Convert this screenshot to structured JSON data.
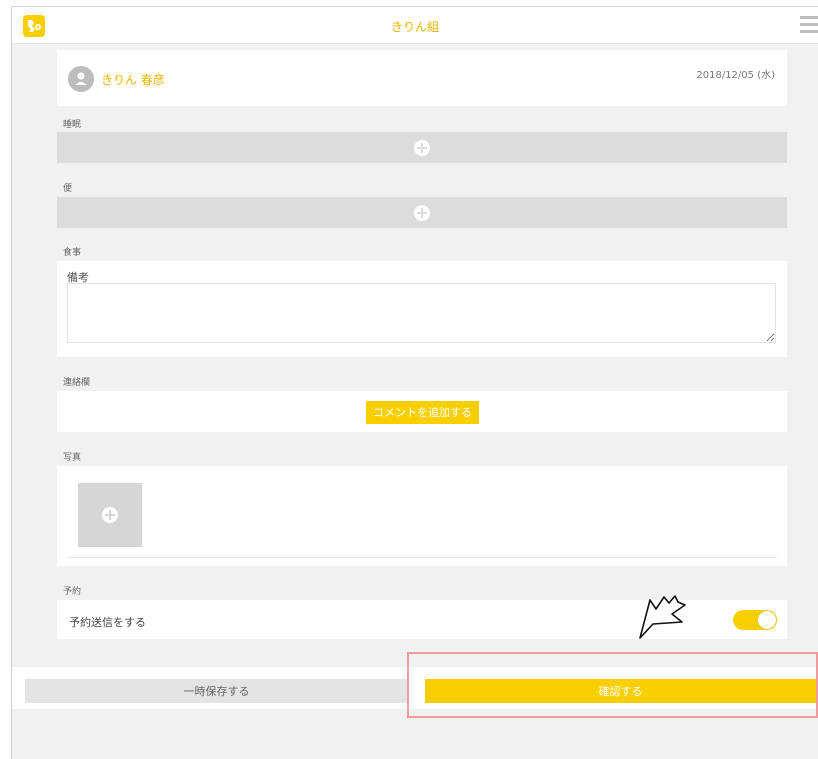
{
  "header": {
    "title": "きりん組"
  },
  "user": {
    "name": "きりん 春彦",
    "date": "2018/12/05 (水)"
  },
  "sections": {
    "sleep": "睡眠",
    "stool": "便",
    "meal": "食事",
    "remarks": "備考",
    "contact": "連絡欄",
    "photo": "写真",
    "reservation": "予約"
  },
  "contact": {
    "add_comment_label": "コメントを追加する"
  },
  "reservation": {
    "send_label": "予約送信をする",
    "toggle_on": true
  },
  "footer": {
    "save_label": "一時保存する",
    "confirm_label": "確認する"
  },
  "colors": {
    "accent": "#f9cf00",
    "highlight": "#ee9b9b",
    "background": "#f1f1f1"
  },
  "icons": [
    "logo-icon",
    "hamburger-menu-icon",
    "avatar-icon",
    "plus-icon",
    "resize-handle-icon",
    "annotation-arrow"
  ]
}
